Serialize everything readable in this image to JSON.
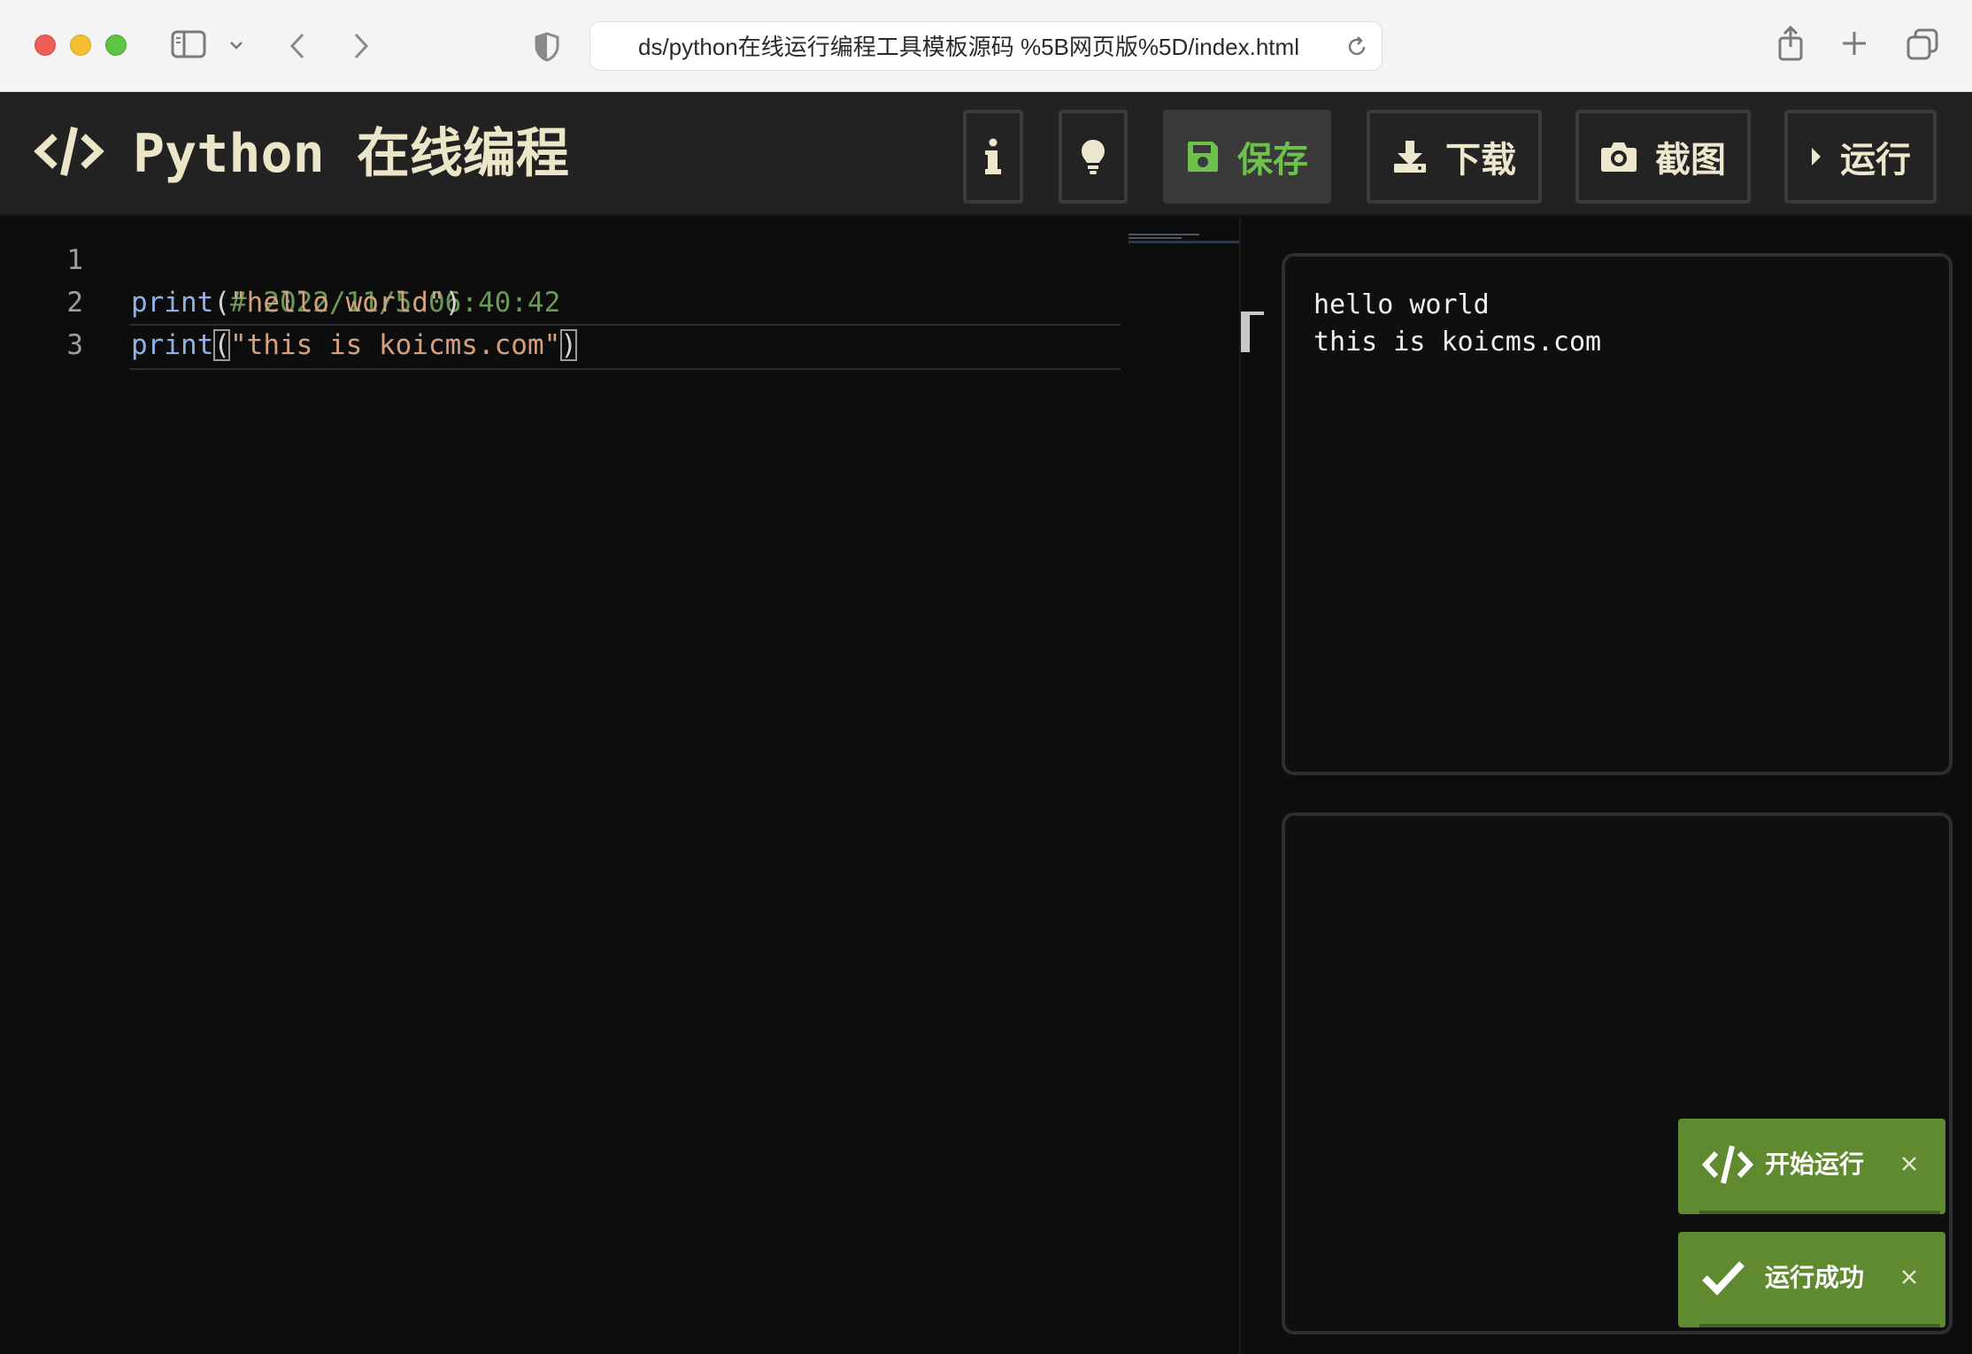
{
  "browser": {
    "url": "ds/python在线运行编程工具模板源码 %5B网页版%5D/index.html"
  },
  "header": {
    "title": "Python 在线编程",
    "buttons": {
      "save": "保存",
      "download": "下载",
      "screenshot": "截图",
      "run": "运行"
    }
  },
  "editor": {
    "line_numbers": [
      "1",
      "2",
      "3"
    ],
    "line1": {
      "comment": "# 2022/11/5 06:40:42"
    },
    "line2": {
      "fn": "print",
      "open": "(",
      "str": "\"hello world\"",
      "close": ")"
    },
    "line3": {
      "fn": "print",
      "open": "(",
      "str": "\"this is koicms.com\"",
      "close": ")"
    },
    "current_line": 3
  },
  "output": {
    "text": "hello world\nthis is koicms.com"
  },
  "toasts": [
    {
      "label": "开始运行",
      "icon": "code-icon",
      "progress": 0.98
    },
    {
      "label": "运行成功",
      "icon": "check-icon",
      "progress": 0.98
    }
  ],
  "colors": {
    "accent_green": "#6cc24a",
    "toast_green": "#5f8a2f",
    "title_cream": "#ece6c9",
    "comment": "#6a9955",
    "function": "#8fb3e8",
    "string": "#d5a07f"
  }
}
